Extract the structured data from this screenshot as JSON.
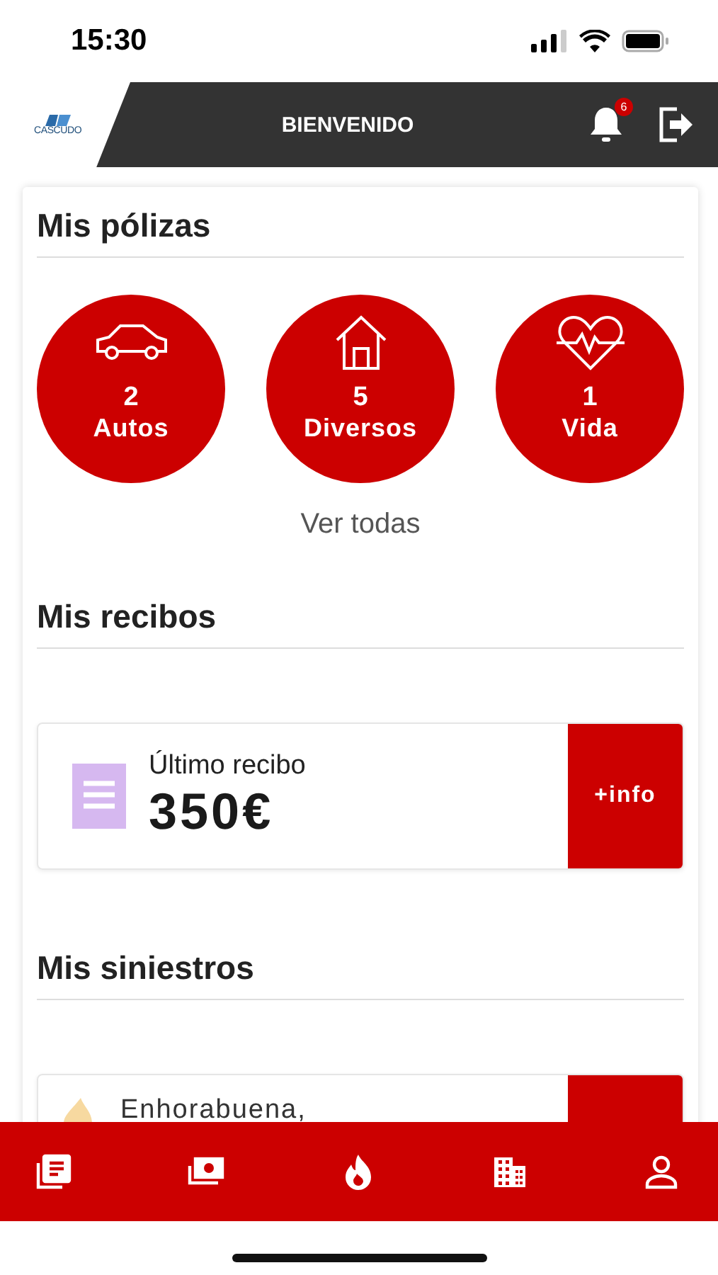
{
  "status_bar": {
    "time": "15:30"
  },
  "header": {
    "logo": "CASCUDO",
    "title": "BIENVENIDO",
    "notifications": "6"
  },
  "policies": {
    "title": "Mis pólizas",
    "items": [
      {
        "kind": "car",
        "count": "2",
        "label": "Autos"
      },
      {
        "kind": "house",
        "count": "5",
        "label": "Diversos"
      },
      {
        "kind": "heart",
        "count": "1",
        "label": "Vida"
      }
    ],
    "link": "Ver todas"
  },
  "receipts": {
    "title": "Mis recibos",
    "card": {
      "label": "Último recibo",
      "amount": "350€",
      "button": "+info"
    }
  },
  "claims": {
    "title": "Mis siniestros",
    "card": {
      "label": "Enhorabuena,"
    }
  },
  "bottom_nav": [
    {
      "kind": "policies"
    },
    {
      "kind": "receipts"
    },
    {
      "kind": "claims"
    },
    {
      "kind": "offices"
    },
    {
      "kind": "profile"
    }
  ]
}
